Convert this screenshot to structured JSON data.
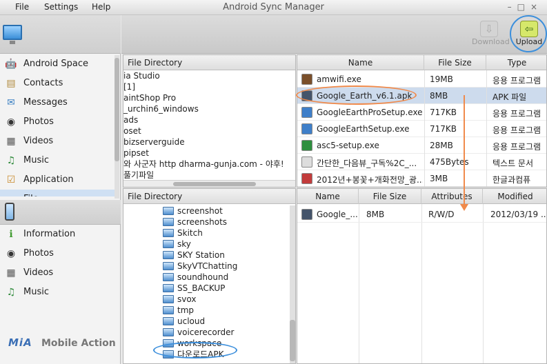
{
  "menu": [
    "File",
    "Settings",
    "Help"
  ],
  "app_title": "Android Sync Manager",
  "window_controls": [
    "–",
    "□",
    "×"
  ],
  "toolbar": {
    "download_label": "Download",
    "upload_label": "Upload"
  },
  "sidebar": {
    "pc_items": [
      {
        "label": "Android Space",
        "icon": "android-icon"
      },
      {
        "label": "Contacts",
        "icon": "contacts-icon"
      },
      {
        "label": "Messages",
        "icon": "messages-icon"
      },
      {
        "label": "Photos",
        "icon": "camera-icon"
      },
      {
        "label": "Videos",
        "icon": "film-icon"
      },
      {
        "label": "Music",
        "icon": "music-icon"
      },
      {
        "label": "Application",
        "icon": "application-icon"
      },
      {
        "label": "File",
        "icon": "file-icon"
      }
    ],
    "phone_items": [
      {
        "label": "Information",
        "icon": "information-icon"
      },
      {
        "label": "Photos",
        "icon": "camera-icon"
      },
      {
        "label": "Videos",
        "icon": "film-icon"
      },
      {
        "label": "Music",
        "icon": "music-icon"
      }
    ],
    "brand_logo": "MiA",
    "brand_text": "Mobile Action"
  },
  "pc_tree": {
    "header": "File Directory",
    "items": [
      "ia Studio",
      "[1]",
      "aintShop Pro",
      "_urchin6_windows",
      "ads",
      "oset",
      "bizserverguide",
      "pipset",
      "와 사군자 http   dharma-gunja.com - 야후!",
      "풀기파일"
    ]
  },
  "pc_files": {
    "columns": [
      "Name",
      "File Size",
      "Type"
    ],
    "rows": [
      {
        "name": "amwifi.exe",
        "size": "19MB",
        "type": "응용 프로그램",
        "icon_color": "#7a4f2a"
      },
      {
        "name": "Google_Earth_v6.1.apk",
        "size": "8MB",
        "type": "APK 파일",
        "icon_color": "#44546a",
        "selected": true
      },
      {
        "name": "GoogleEarthProSetup.exe",
        "size": "717KB",
        "type": "응용 프로그램",
        "icon_color": "#3f7fc9"
      },
      {
        "name": "GoogleEarthSetup.exe",
        "size": "717KB",
        "type": "응용 프로그램",
        "icon_color": "#3f7fc9"
      },
      {
        "name": "asc5-setup.exe",
        "size": "28MB",
        "type": "응용 프로그램",
        "icon_color": "#2f8f3f"
      },
      {
        "name": "간단한_다음뷰_구독%2C_...",
        "size": "475Bytes",
        "type": "텍스트 문서",
        "icon_color": "#dddddd"
      },
      {
        "name": "2012년+봉꽃+개화전망_광...",
        "size": "3MB",
        "type": "한글과컴퓨",
        "icon_color": "#c23b3b"
      }
    ]
  },
  "phone_tree": {
    "header": "File Directory",
    "items": [
      "screenshot",
      "screenshots",
      "Skitch",
      "sky",
      "SKY Station",
      "SkyVTChatting",
      "soundhound",
      "SS_BACKUP",
      "svox",
      "tmp",
      "ucloud",
      "voicerecorder",
      "workspace",
      "다운로드APK"
    ]
  },
  "phone_files": {
    "columns": [
      "Name",
      "File Size",
      "Attributes",
      "Modified"
    ],
    "rows": [
      {
        "name": "Google_...",
        "size": "8MB",
        "attributes": "R/W/D",
        "modified": "2012/03/19 ..."
      }
    ]
  },
  "colors": {
    "highlight_orange": "#f08a4b",
    "highlight_blue": "#3c8fdc",
    "selection": "#cddbed"
  }
}
